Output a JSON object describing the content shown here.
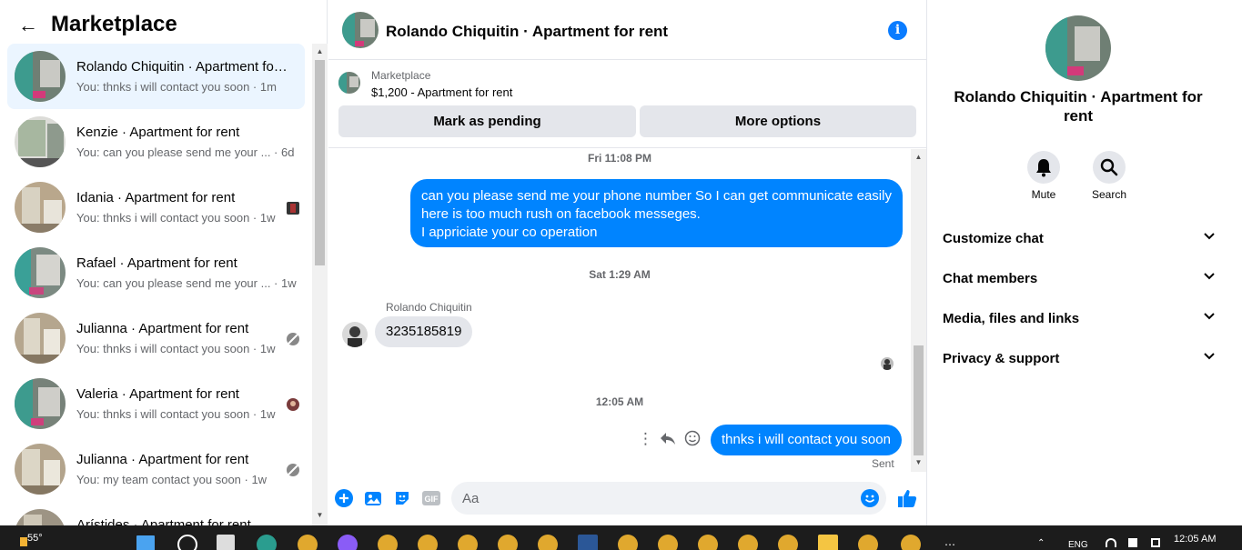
{
  "colors": {
    "accent": "#0084ff",
    "bubble_in": "#e4e6eb",
    "active_row": "#ebf5ff",
    "taskbar": "#1c1c1c"
  },
  "left": {
    "title": "Marketplace",
    "back_icon": "arrow-left-icon",
    "conversations": [
      {
        "name": "Rolando Chiquitin · Apartment for rent",
        "snippet": "You: thnks i will contact you soon · 1m",
        "active": true
      },
      {
        "name": "Kenzie · Apartment for rent",
        "snippet": "You: can you please send me your ... · 6d"
      },
      {
        "name": "Idania · Apartment for rent",
        "snippet": "You: thnks i will contact you soon · 1w"
      },
      {
        "name": "Rafael · Apartment for rent",
        "snippet": "You: can you please send me your ... · 1w"
      },
      {
        "name": "Julianna · Apartment for rent",
        "snippet": "You: thnks i will contact you soon · 1w"
      },
      {
        "name": "Valeria · Apartment for rent",
        "snippet": "You: thnks i will contact you soon · 1w"
      },
      {
        "name": "Julianna · Apartment for rent",
        "snippet": "You: my team contact you soon · 1w"
      },
      {
        "name": "Arístides · Apartment for rent",
        "snippet": ""
      }
    ]
  },
  "header": {
    "title": "Rolando Chiquitin · Apartment for rent",
    "info_icon": "i"
  },
  "listing": {
    "label": "Marketplace",
    "price": "$1,200 - Apartment for rent",
    "pending_label": "Mark as pending",
    "more_label": "More options"
  },
  "thread": {
    "ts1": "Fri 11:08 PM",
    "msg1_line1": "can you please send me your phone number So I can get communicate easily",
    "msg1_line2": "here is too much rush on facebook messeges.",
    "msg1_line3": "I appriciate your co operation",
    "ts2": "Sat 1:29 AM",
    "sender": "Rolando Chiquitin",
    "msg2": "3235185819",
    "ts3": "12:05 AM",
    "msg3": "thnks i will contact you soon",
    "status": "Sent"
  },
  "composer": {
    "placeholder": "Aa",
    "gif_label": "GIF"
  },
  "details": {
    "name": "Rolando Chiquitin · Apartment for rent",
    "mute_label": "Mute",
    "search_label": "Search",
    "sections": [
      "Customize chat",
      "Chat members",
      "Media, files and links",
      "Privacy & support"
    ]
  },
  "taskbar": {
    "temperature": "55°",
    "lang": "ENG",
    "time": "12:05 AM"
  }
}
